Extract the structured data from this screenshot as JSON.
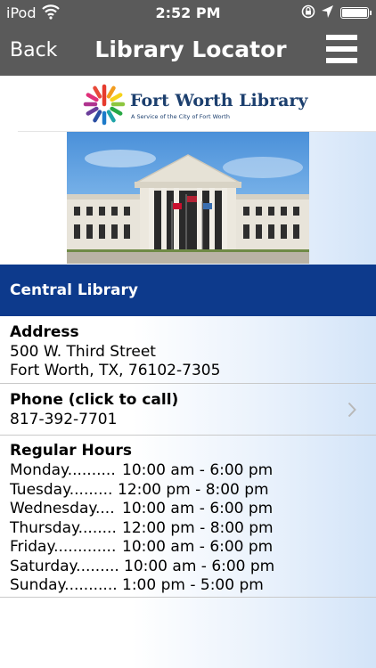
{
  "status_bar": {
    "carrier": "iPod",
    "time": "2:52 PM"
  },
  "nav": {
    "back_label": "Back",
    "title": "Library Locator"
  },
  "logo": {
    "title": "Fort Worth Library",
    "subtitle": "A Service of the City of Fort Worth"
  },
  "library": {
    "name": "Central Library"
  },
  "address": {
    "heading": "Address",
    "line1": "500 W. Third Street",
    "line2": "Fort Worth, TX, 76102-7305"
  },
  "phone": {
    "heading": "Phone (click to call)",
    "number": "817-392-7701"
  },
  "hours": {
    "heading": "Regular Hours",
    "rows": [
      {
        "day": "Monday..........",
        "time": "10:00 am - 6:00 pm"
      },
      {
        "day": "Tuesday.........",
        "time": "12:00 pm - 8:00 pm"
      },
      {
        "day": "Wednesday....",
        "time": "10:00 am - 6:00 pm"
      },
      {
        "day": "Thursday........",
        "time": "12:00 pm - 8:00 pm"
      },
      {
        "day": "Friday.............",
        "time": "10:00 am - 6:00 pm"
      },
      {
        "day": "Saturday.........",
        "time": "10:00 am - 6:00 pm"
      },
      {
        "day": "Sunday...........",
        "time": "1:00 pm - 5:00 pm"
      }
    ]
  },
  "colors": {
    "nav_bar": "#5a5a5a",
    "banner": "#0d3a8c",
    "logo_text": "#1c3f6e"
  },
  "icons": {
    "wifi": "wifi-icon",
    "orientation_lock": "orientation-lock-icon",
    "location": "location-arrow-icon",
    "battery": "battery-icon",
    "menu": "hamburger-menu-icon",
    "chevron": "chevron-right-icon"
  }
}
